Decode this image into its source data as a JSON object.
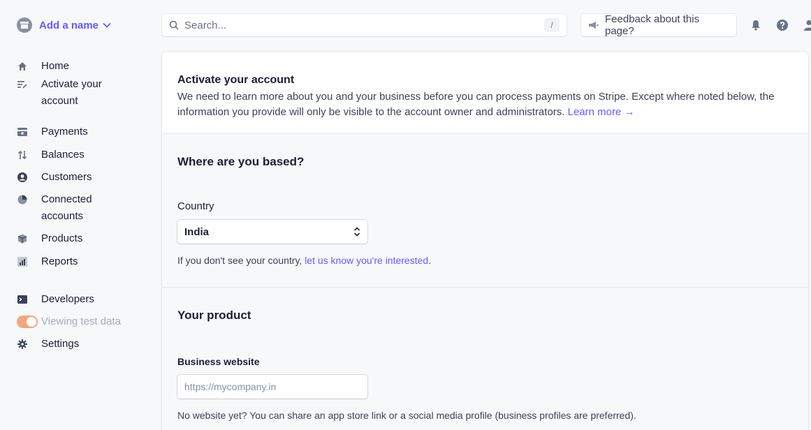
{
  "account": {
    "name": "Add a name"
  },
  "search": {
    "placeholder": "Search...",
    "shortcut": "/"
  },
  "feedback": {
    "label": "Feedback about this page?"
  },
  "nav": {
    "home": "Home",
    "activate": "Activate your account",
    "payments": "Payments",
    "balances": "Balances",
    "customers": "Customers",
    "connected": "Connected accounts",
    "products": "Products",
    "reports": "Reports",
    "developers": "Developers",
    "test_data": "Viewing test data",
    "settings": "Settings"
  },
  "intro": {
    "title": "Activate your account",
    "body": "We need to learn more about you and your business before you can process payments on Stripe. Except where noted below, the information you provide will only be visible to the account owner and administrators.",
    "learn_more": "Learn more →"
  },
  "based": {
    "heading": "Where are you based?",
    "country_label": "Country",
    "country_value": "India",
    "hint_prefix": "If you don't see your country,",
    "hint_link": "let us know you're interested",
    "hint_suffix": "."
  },
  "product": {
    "heading": "Your product",
    "website_label": "Business website",
    "website_placeholder": "https://mycompany.in",
    "hint": "No website yet? You can share an app store link or a social media profile (business profiles are preferred)."
  },
  "colors": {
    "accent": "#635bff",
    "text": "#1a1f36",
    "muted": "#697386",
    "toggle": "#f1a77e"
  }
}
